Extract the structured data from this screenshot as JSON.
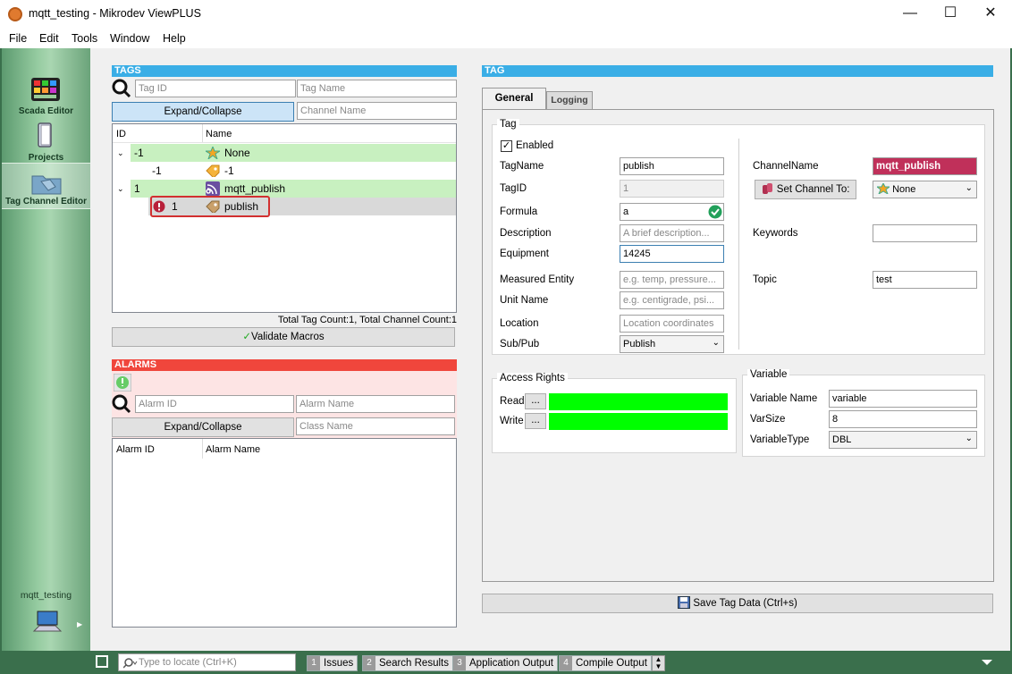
{
  "window": {
    "title": "mqtt_testing - Mikrodev ViewPLUS"
  },
  "menu": [
    "File",
    "Edit",
    "Tools",
    "Window",
    "Help"
  ],
  "sidebar": {
    "items": [
      {
        "label": "Scada Editor",
        "icon": "scada-editor-icon"
      },
      {
        "label": "Projects",
        "icon": "projects-icon"
      },
      {
        "label": "Tag Channel Editor",
        "icon": "tag-channel-editor-icon"
      }
    ],
    "project": "mqtt_testing"
  },
  "tags": {
    "header": "TAGS",
    "tag_id_placeholder": "Tag ID",
    "tag_name_placeholder": "Tag Name",
    "channel_name_placeholder": "Channel Name",
    "expand_label": "Expand/Collapse",
    "col_id": "ID",
    "col_name": "Name",
    "rows": [
      {
        "id": "-1",
        "name": "None",
        "level": 0,
        "group": true
      },
      {
        "id": "-1",
        "name": "-1",
        "level": 1,
        "group": false
      },
      {
        "id": "1",
        "name": "mqtt_publish",
        "level": 0,
        "group": true
      },
      {
        "id": "1",
        "name": "publish",
        "level": 1,
        "group": false,
        "error": true,
        "selected": true
      }
    ],
    "totals": "Total Tag Count:1, Total Channel Count:1",
    "validate_label": "Validate Macros"
  },
  "alarms": {
    "header": "ALARMS",
    "alarm_id_placeholder": "Alarm ID",
    "alarm_name_placeholder": "Alarm Name",
    "class_name_placeholder": "Class Name",
    "expand_label": "Expand/Collapse",
    "col_id": "Alarm ID",
    "col_name": "Alarm Name"
  },
  "tag": {
    "header": "TAG",
    "tabs": [
      "General",
      "Logging"
    ],
    "group_title": "Tag",
    "enabled_label": "Enabled",
    "fields": {
      "tagname_label": "TagName",
      "tagname": "publish",
      "tagid_label": "TagID",
      "tagid": "1",
      "formula_label": "Formula",
      "formula": "a",
      "description_label": "Description",
      "description_ph": "A brief description...",
      "equipment_label": "Equipment",
      "equipment": "14245",
      "measured_label": "Measured Entity",
      "measured_ph": "e.g. temp, pressure...",
      "unit_label": "Unit Name",
      "unit_ph": "e.g. centigrade, psi...",
      "location_label": "Location",
      "location_ph": "Location coordinates",
      "subpub_label": "Sub/Pub",
      "subpub": "Publish",
      "channelname_label": "ChannelName",
      "channelname": "mqtt_publish",
      "set_channel_label": "Set Channel To:",
      "set_channel_value": "None",
      "keywords_label": "Keywords",
      "keywords": "",
      "topic_label": "Topic",
      "topic": "test"
    },
    "access": {
      "title": "Access Rights",
      "read_label": "Read",
      "write_label": "Write",
      "dots": "...",
      "color": "#00ff00"
    },
    "variable": {
      "title": "Variable",
      "name_label": "Variable Name",
      "name": "variable",
      "size_label": "VarSize",
      "size": "8",
      "type_label": "VariableType",
      "type": "DBL"
    },
    "save_label": "Save Tag Data (Ctrl+s)"
  },
  "statusbar": {
    "locate_placeholder": "Type to locate (Ctrl+K)",
    "tabs": [
      {
        "num": "1",
        "label": "Issues"
      },
      {
        "num": "2",
        "label": "Search Results"
      },
      {
        "num": "3",
        "label": "Application Output"
      },
      {
        "num": "4",
        "label": "Compile Output"
      }
    ]
  },
  "colors": {
    "tags_header": "#3aaee6",
    "alarms_header": "#f0463c",
    "group_row": "#c8f0c0",
    "channel_badge": "#c0305a"
  }
}
